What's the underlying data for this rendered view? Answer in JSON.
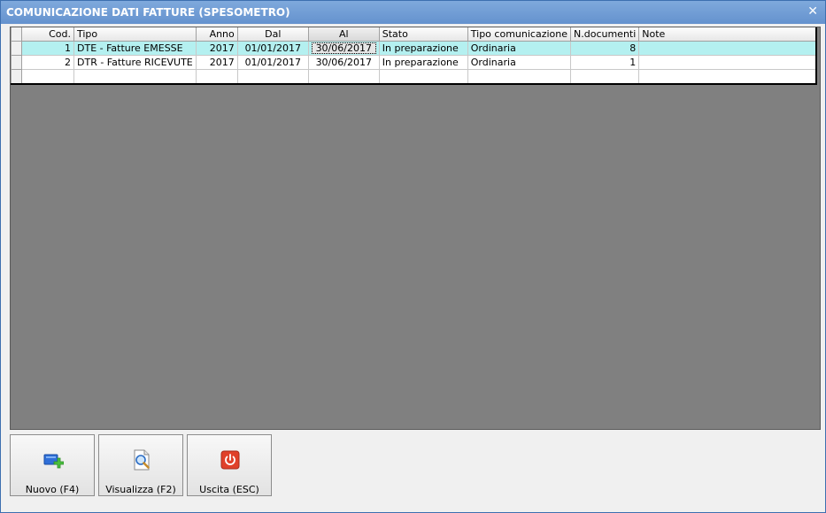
{
  "window": {
    "title": "COMUNICAZIONE DATI FATTURE (SPESOMETRO)",
    "close_glyph": "✕"
  },
  "grid": {
    "columns": [
      "Cod.",
      "Tipo",
      "Anno",
      "Dal",
      "Al",
      "Stato",
      "Tipo comunicazione",
      "N.documenti",
      "Note"
    ],
    "rows": [
      {
        "cod": "1",
        "tipo": "DTE - Fatture EMESSE",
        "anno": "2017",
        "dal": "01/01/2017",
        "al": "30/06/2017",
        "stato": "In preparazione",
        "tipo_comunicazione": "Ordinaria",
        "n_documenti": "8",
        "note": ""
      },
      {
        "cod": "2",
        "tipo": "DTR - Fatture RICEVUTE",
        "anno": "2017",
        "dal": "01/01/2017",
        "al": "30/06/2017",
        "stato": "In preparazione",
        "tipo_comunicazione": "Ordinaria",
        "n_documenti": "1",
        "note": ""
      }
    ],
    "selected_row": 1
  },
  "buttons": {
    "nuovo": {
      "label": "Nuovo (F4)",
      "icon": "add-icon"
    },
    "visualizza": {
      "label": "Visualizza (F2)",
      "icon": "magnifier-document-icon"
    },
    "uscita": {
      "label": "Uscita (ESC)",
      "icon": "power-icon"
    }
  },
  "colors": {
    "titlebar": "#6f9bd1",
    "selected_row": "#b4f0f0",
    "grid_background": "#808080",
    "exit_red": "#e0412a"
  }
}
